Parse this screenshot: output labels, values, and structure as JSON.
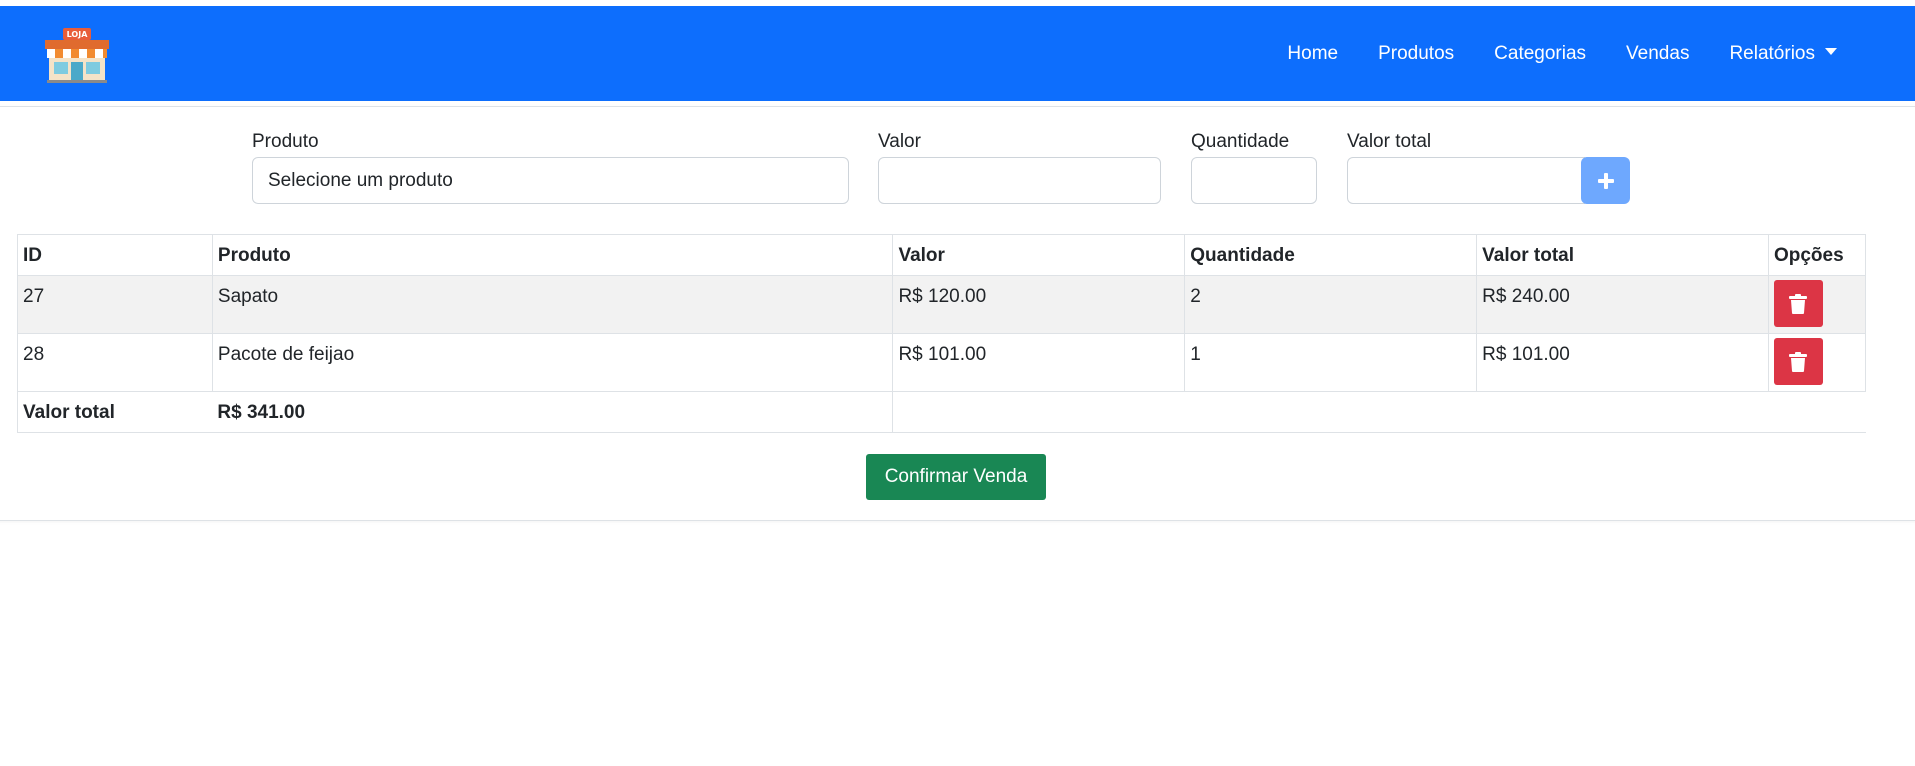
{
  "navbar": {
    "logo_text": "LOJA",
    "links": [
      {
        "label": "Home"
      },
      {
        "label": "Produtos"
      },
      {
        "label": "Categorias"
      },
      {
        "label": "Vendas"
      },
      {
        "label": "Relatórios"
      }
    ],
    "bg_color": "#0d6efd"
  },
  "form": {
    "produto_label": "Produto",
    "produto_value": "Selecione um produto",
    "valor_label": "Valor",
    "valor_value": "",
    "quantidade_label": "Quantidade",
    "quantidade_value": "",
    "valor_total_label": "Valor total",
    "valor_total_value": "",
    "add_icon": "plus-icon"
  },
  "table": {
    "headers": [
      "ID",
      "Produto",
      "Valor",
      "Quantidade",
      "Valor total",
      "Opções"
    ],
    "rows": [
      {
        "id": "27",
        "produto": "Sapato",
        "valor": "R$ 120.00",
        "quantidade": "2",
        "valor_total": "R$ 240.00"
      },
      {
        "id": "28",
        "produto": "Pacote de feijao",
        "valor": "R$ 101.00",
        "quantidade": "1",
        "valor_total": "R$ 101.00"
      }
    ],
    "delete_icon": "trash-icon",
    "total_label": "Valor total",
    "total_value": "R$ 341.00"
  },
  "confirm_label": "Confirmar Venda",
  "colors": {
    "primary": "#0d6efd",
    "danger": "#dc3545",
    "success": "#198754",
    "add_button": "#6ea8fe"
  }
}
